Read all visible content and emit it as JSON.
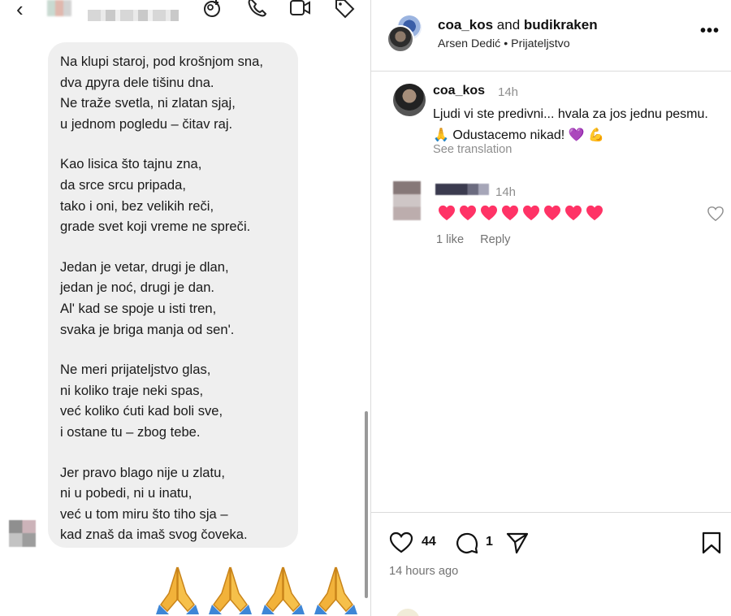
{
  "chat": {
    "back_icon": "chevron-left-icon",
    "header_icons": [
      "add-participant-icon",
      "phone-icon",
      "video-icon",
      "tag-icon"
    ],
    "poem": [
      [
        "Na klupi staroj, pod krošnjom sna,",
        "dva друга dele tišinu dna.",
        "Ne traže svetla, ni zlatan sjaj,",
        "u jednom pogledu – čitav raj."
      ],
      [
        "Kao lisica što tajnu zna,",
        "da srce srcu pripada,",
        "tako i oni, bez velikih reči,",
        "grade svet koji vreme ne spreči."
      ],
      [
        "Jedan je vetar, drugi je dlan,",
        "jedan je noć, drugi je dan.",
        "Al' kad se spoje u isti tren,",
        "svaka je briga manja od sen'."
      ],
      [
        "Ne meri prijateljstvo glas,",
        "ni koliko traje neki spas,",
        "već koliko ćuti kad boli sve,",
        "i ostane tu – zbog tebe."
      ],
      [
        "Jer pravo blago nije u zlatu,",
        "ni u pobedi, ni u inatu,",
        "već u tom miru što tiho sja –",
        "kad znaš da imaš svog čoveka."
      ]
    ],
    "reaction_emoji": [
      "🙏",
      "🙏",
      "🙏",
      "🙏"
    ]
  },
  "post": {
    "user1": "coa_kos",
    "and_text": "and",
    "user2": "budikraken",
    "subtitle": "Arsen Dedić • Prijateljstvo",
    "more_label": "•••",
    "comments": [
      {
        "user": "coa_kos",
        "time": "14h",
        "text": "Ljudi vi ste predivni... hvala za jos jednu pesmu. 🙏 Odustacemo nikad! 💜 💪",
        "translation": "See translation"
      },
      {
        "time": "14h",
        "heart_count": 8,
        "likes": "1 like",
        "reply": "Reply"
      }
    ],
    "likes_count": "44",
    "comments_count": "1",
    "time_ago": "14 hours ago",
    "colors": {
      "heart": "#ff3366",
      "muted": "#8e8e8e",
      "divider": "#dbdbdb"
    }
  }
}
